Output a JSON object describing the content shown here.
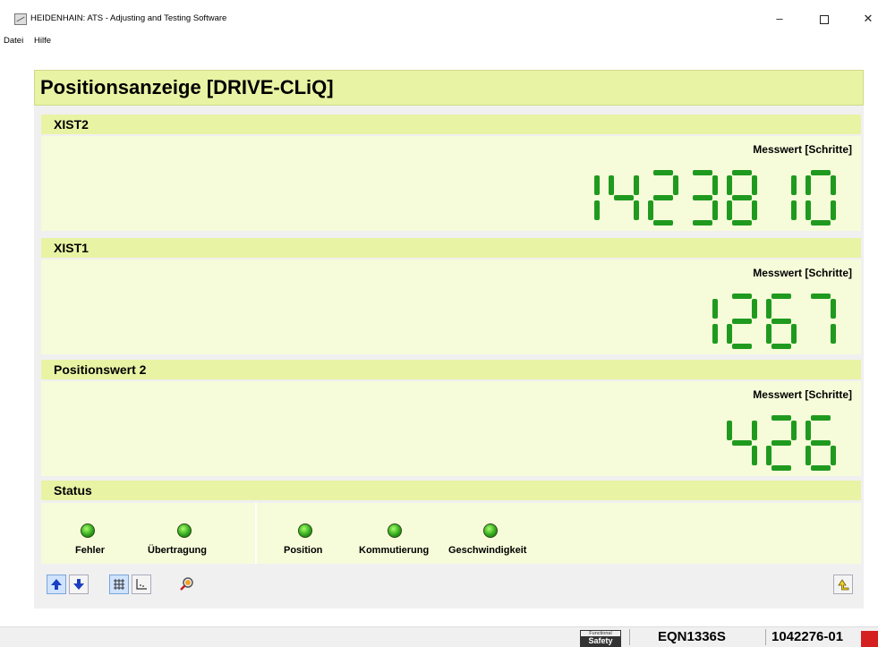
{
  "window": {
    "title": "HEIDENHAIN: ATS - Adjusting and Testing Software"
  },
  "menu": [
    "Datei",
    "Hilfe"
  ],
  "panel": {
    "title": "Positionsanzeige [DRIVE-CLiQ]"
  },
  "sections": [
    {
      "name": "XIST2",
      "label": "Messwert [Schritte]",
      "value": "1423810"
    },
    {
      "name": "XIST1",
      "label": "Messwert [Schritte]",
      "value": "1267"
    },
    {
      "name": "Positionswert 2",
      "label": "Messwert [Schritte]",
      "value": "426"
    }
  ],
  "status": {
    "title": "Status",
    "leds": [
      "Fehler",
      "Übertragung",
      "Position",
      "Kommutierung",
      "Geschwindigkeit"
    ],
    "led_color": "#33a81d"
  },
  "toolbar": [
    "arrow-up-icon",
    "arrow-down-icon",
    "grid-icon",
    "axis-icon",
    "magnifier-icon",
    "return-icon"
  ],
  "statusbar": {
    "badge_top": "Functional",
    "badge_bottom": "Safety",
    "model": "EQN1336S",
    "id": "1042276-01"
  },
  "colors": {
    "header": "#e9f3a4",
    "body": "#f6fbd9",
    "digits": "#1f9a1f"
  }
}
